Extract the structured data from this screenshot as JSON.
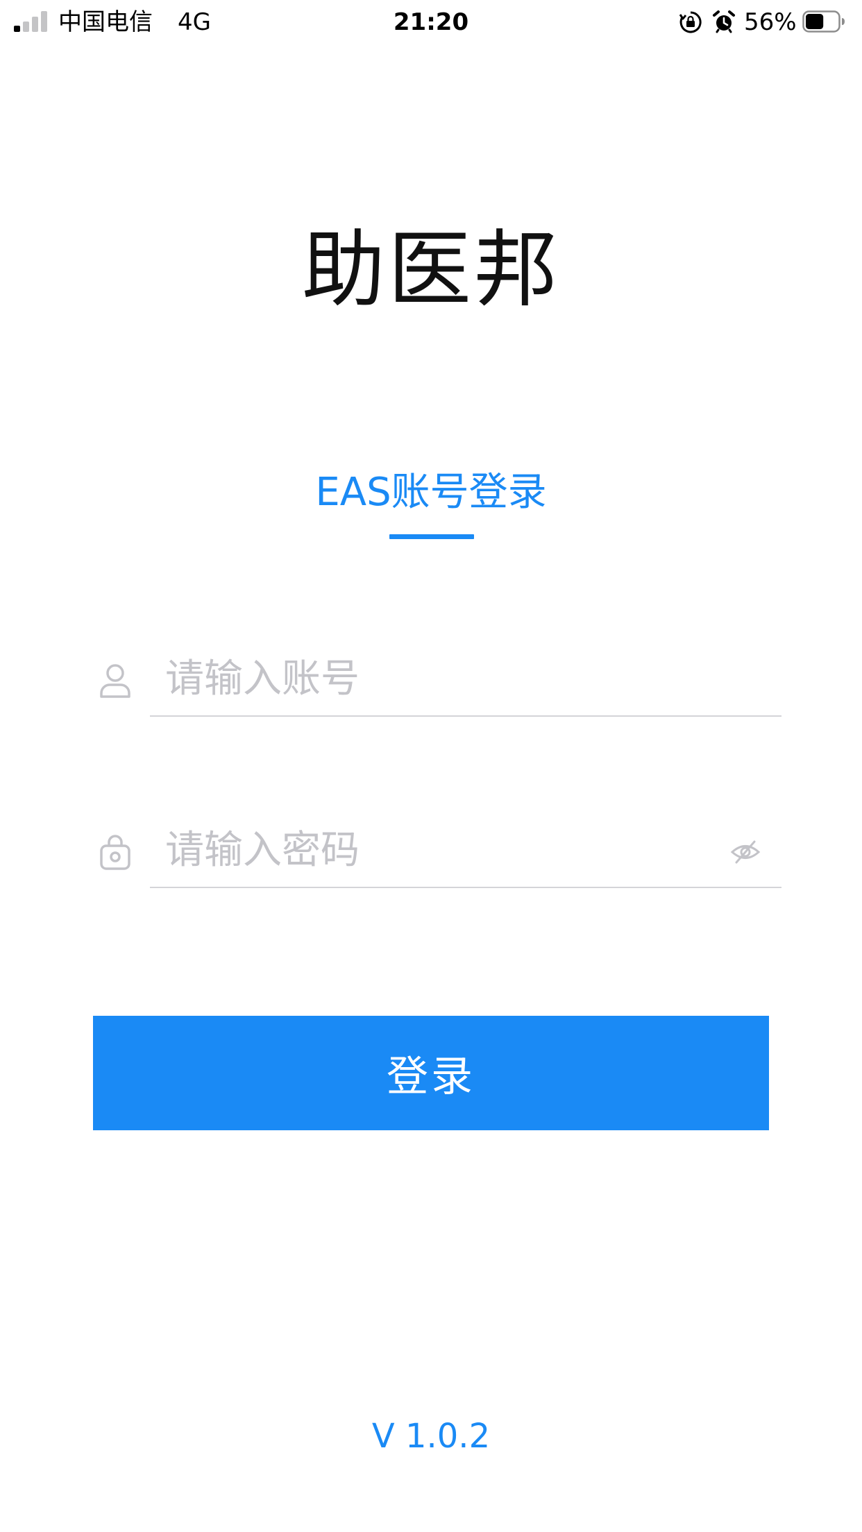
{
  "status_bar": {
    "carrier": "中国电信",
    "network": "4G",
    "time": "21:20",
    "battery_percent": "56%",
    "battery_level": 0.56,
    "signal_bars_active": 1,
    "signal_bars_total": 4,
    "icons": [
      "signal-icon",
      "orientation-lock-icon",
      "alarm-icon",
      "battery-icon"
    ]
  },
  "app": {
    "title": "助医邦"
  },
  "tabs": [
    {
      "label": "EAS账号登录",
      "active": true
    }
  ],
  "form": {
    "account": {
      "placeholder": "请输入账号",
      "value": "",
      "icon": "user-icon"
    },
    "password": {
      "placeholder": "请输入密码",
      "value": "",
      "icon": "lock-icon",
      "toggle_icon": "eye-slash-icon"
    },
    "submit_label": "登录"
  },
  "footer": {
    "version": "V 1.0.2"
  },
  "colors": {
    "accent": "#1a8af5",
    "placeholder": "#c3c3c8",
    "divider": "#d4d4d8",
    "background": "#ffffff"
  }
}
